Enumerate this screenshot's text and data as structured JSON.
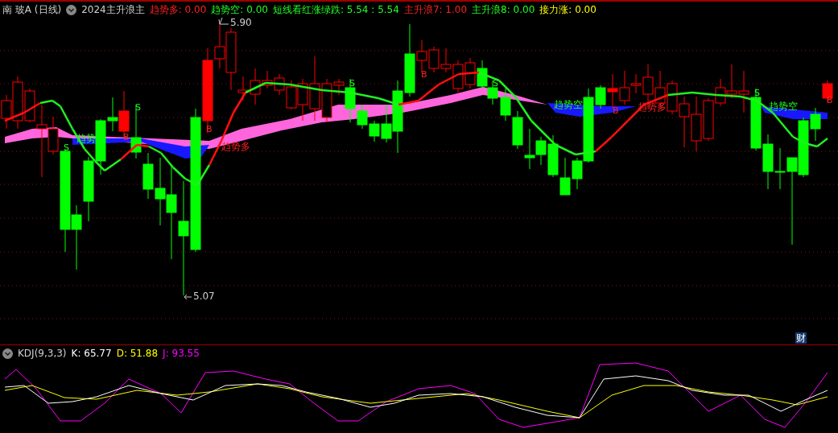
{
  "header": {
    "title": "南 玻A (日线)",
    "indicator": "2024主升浪主",
    "values": [
      {
        "text": "趋势多: 0.00",
        "color": "#ff2020"
      },
      {
        "text": "趋势空: 0.00",
        "color": "#20ff20"
      },
      {
        "text": "短线看红涨绿跌: 5.54 : 5.54",
        "color": "#20ff20"
      },
      {
        "text": "主升浪7: 1.00",
        "color": "#ff2020"
      },
      {
        "text": "主升浪8: 0.00",
        "color": "#20ff20"
      },
      {
        "text": "接力涨: 0.00",
        "color": "#ffff00"
      }
    ]
  },
  "chart": {
    "price_labels": [
      {
        "kind": "high",
        "text": "5.90"
      },
      {
        "kind": "low",
        "text": "5.07"
      }
    ],
    "signals": [
      {
        "kind": "sell",
        "text": "S"
      },
      {
        "kind": "buy",
        "text": "B"
      },
      {
        "kind": "sell",
        "text": "S"
      },
      {
        "kind": "buy",
        "text": "B"
      },
      {
        "kind": "sell",
        "text": "S"
      },
      {
        "kind": "buy",
        "text": "B"
      },
      {
        "kind": "sell",
        "text": "S"
      },
      {
        "kind": "buy",
        "text": "B"
      },
      {
        "kind": "sell",
        "text": "S"
      },
      {
        "kind": "buy",
        "text": "B"
      }
    ],
    "trend_labels": [
      {
        "kind": "short",
        "text": "趋势"
      },
      {
        "kind": "long",
        "text": "趋势多"
      },
      {
        "kind": "short",
        "text": "趋势空"
      },
      {
        "kind": "long",
        "text": "趋势多"
      },
      {
        "kind": "short",
        "text": "趋势空"
      }
    ],
    "badge": "财"
  },
  "kdj": {
    "title": "KDJ(9,3,3)",
    "values": [
      {
        "text": "K: 65.77",
        "color": "#ffffff"
      },
      {
        "text": "D: 51.88",
        "color": "#ffff00"
      },
      {
        "text": "J: 93.55",
        "color": "#ff00ff"
      }
    ]
  }
}
